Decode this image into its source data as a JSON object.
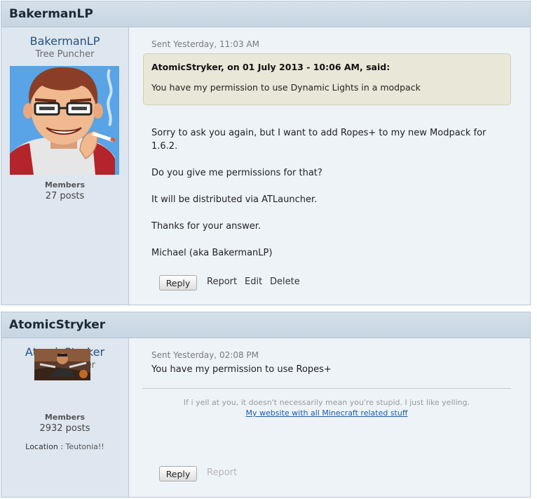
{
  "posts": [
    {
      "header_name": "BakermanLP",
      "author": {
        "name": "BakermanLP",
        "rank": "Tree Puncher",
        "group": "Members",
        "posts": "27 posts",
        "avatar_icon": "cartoon-avatar-icon"
      },
      "sent": "Sent Yesterday, 11:03 AM",
      "quote": {
        "cite": "AtomicStryker, on 01 July 2013 - 10:06 AM, said:",
        "text": "You have my permission to use Dynamic Lights in a modpack"
      },
      "lines": [
        "Sorry to ask you again, but I want to add Ropes+ to my new Modpack for",
        "1.6.2.",
        "Do you give me permissions for that?",
        "It will be distributed via ATLauncher.",
        "Thanks for your answer.",
        "Michael (aka BakermanLP)"
      ],
      "actions": {
        "reply": "Reply",
        "report": "Report",
        "edit": "Edit",
        "delete": "Delete"
      }
    },
    {
      "header_name": "AtomicStryker",
      "author": {
        "name": "AtomicStryker",
        "rank": "Ghast Hunter",
        "group": "Members",
        "posts": "2932 posts",
        "location_label": "Location :",
        "location_value": "Teutonia!!",
        "avatar_icon": "game-character-avatar-icon"
      },
      "sent": "Sent Yesterday, 02:08 PM",
      "lines": [
        "You have my permission to use Ropes+"
      ],
      "signature": {
        "text": "If i yell at you, it doesn't necessarily mean you're stupid. I just like yelling.",
        "link": "My website with all Minecraft related stuff"
      },
      "actions": {
        "reply": "Reply",
        "report": "Report"
      }
    }
  ]
}
